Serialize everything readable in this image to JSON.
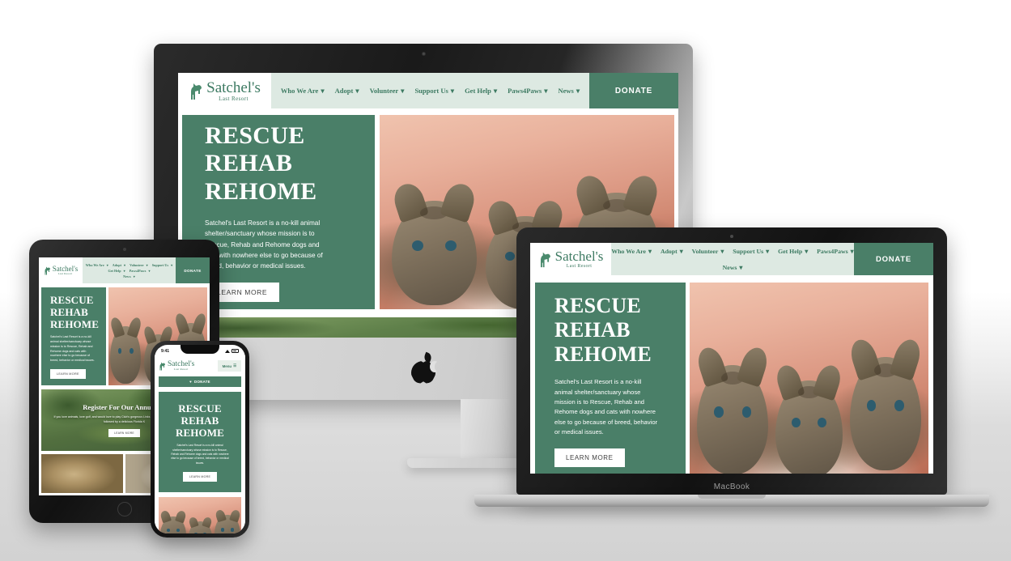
{
  "brand": {
    "name": "Satchel's",
    "tagline": "Last Resort",
    "logo_icon": "dog-silhouette-icon",
    "accent_green": "#4a7f68",
    "nav_bg": "#dde9e2",
    "logo_green": "#3d7a62"
  },
  "nav": {
    "items": [
      {
        "label": "Who We Are",
        "caret": "▾"
      },
      {
        "label": "Adopt",
        "caret": "▾"
      },
      {
        "label": "Volunteer",
        "caret": "▾"
      },
      {
        "label": "Support Us",
        "caret": "▾"
      },
      {
        "label": "Get Help",
        "caret": "▾"
      },
      {
        "label": "Paws4Paws",
        "caret": "▾"
      },
      {
        "label": "News",
        "caret": "▾"
      }
    ],
    "donate_label": "DONATE",
    "menu_label": "Menu",
    "menu_icon": "hamburger-icon",
    "donate_heart_icon": "heart-icon"
  },
  "hero": {
    "line1": "RESCUE",
    "line2": "REHAB",
    "line3": "REHOME",
    "body": "Satchel's Last Resort is a no-kill animal shelter/sanctuary whose mission is to Rescue, Rehab and Rehome dogs and cats with nowhere else to go because of breed, behavior or medical issues.",
    "cta_label": "LEARN MORE",
    "image_alt": "three-tabby-kittens-photo"
  },
  "golf": {
    "heading": "Register For Our Annual Pa",
    "body": "If you love animals, love golf, and would love to play Club's gorgeous Links on Longboat Key Course, please j followed by a delicious Florida K",
    "cta_label": "LEARN MORE",
    "image_alt": "aerial-golf-course-photo"
  },
  "photos": [
    {
      "alt": "shaggy-dog-photo"
    },
    {
      "alt": "dog-shaking-paw-photo"
    }
  ],
  "devices": {
    "imac": {
      "name": "iMac",
      "logo_icon": "apple-logo-icon"
    },
    "macbook": {
      "name": "MacBook",
      "label": "MacBook"
    },
    "ipad": {
      "name": "iPad"
    },
    "iphone": {
      "name": "iPhone",
      "status_time": "9:41"
    }
  }
}
